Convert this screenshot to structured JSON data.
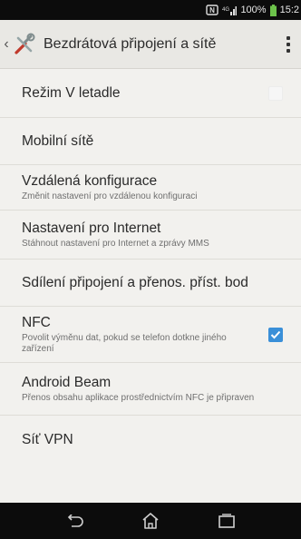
{
  "status_bar": {
    "nfc_icon": "nfc-icon",
    "signal_icon": "signal-icon",
    "battery_percent": "100%",
    "battery_icon": "battery-icon",
    "time": "15:2"
  },
  "action_bar": {
    "back_icon": "chevron-left-icon",
    "app_icon": "wireless-settings-icon",
    "title": "Bezdrátová připojení a sítě",
    "menu_icon": "overflow-menu-icon"
  },
  "settings": [
    {
      "title": "Režim V letadle",
      "summary": "",
      "checkbox": false
    },
    {
      "title": "Mobilní sítě",
      "summary": ""
    },
    {
      "title": "Vzdálená konfigurace",
      "summary": "Změnit nastavení pro vzdálenou konfiguraci"
    },
    {
      "title": "Nastavení pro Internet",
      "summary": "Stáhnout nastavení pro Internet a zprávy MMS"
    },
    {
      "title": "Sdílení připojení a přenos. příst. bod",
      "summary": ""
    },
    {
      "title": "NFC",
      "summary": "Povolit výměnu dat, pokud se telefon dotkne jiného zařízení",
      "checkbox": true
    },
    {
      "title": "Android Beam",
      "summary": "Přenos obsahu aplikace prostřednictvím NFC je připraven"
    },
    {
      "title": "Síť VPN",
      "summary": ""
    }
  ],
  "nav_bar": {
    "back": "back-icon",
    "home": "home-icon",
    "recents": "recent-apps-icon"
  },
  "colors": {
    "accent": "#3a8fd8",
    "battery": "#6cc24a",
    "background": "#f2f1ee"
  }
}
